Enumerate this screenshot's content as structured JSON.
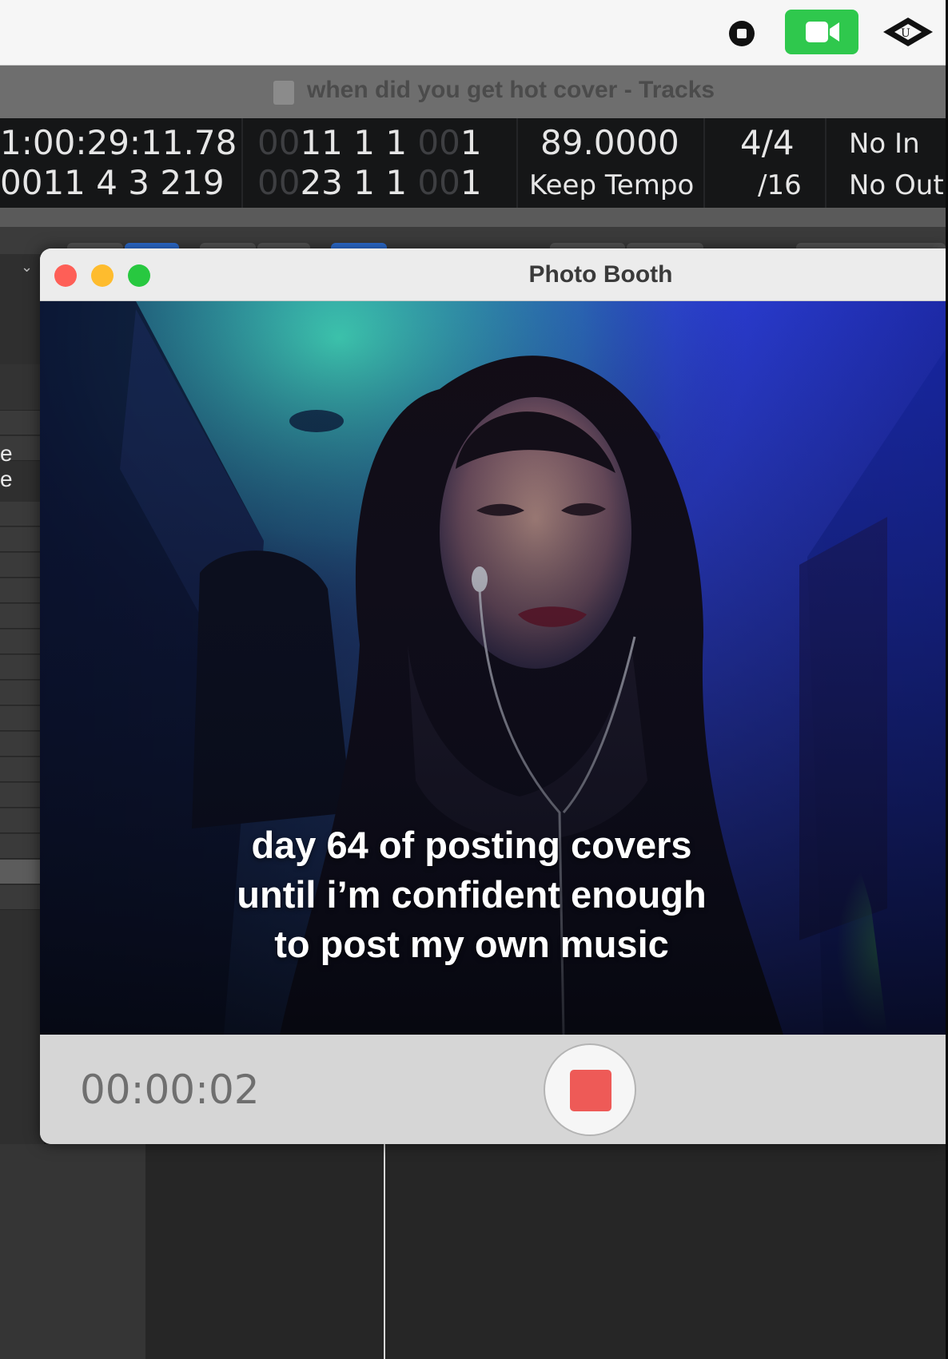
{
  "menubar": {
    "icons": [
      "screen-record-icon",
      "facetime-camera-icon",
      "universal-audio-icon"
    ],
    "facetime_color": "#2fc84d"
  },
  "logic": {
    "window_title": "when did you get hot cover - Tracks",
    "lcd": {
      "smpte_time": "1:00:29:11.78",
      "smpte_end": "0011 4 3 219",
      "bar_position": [
        "00",
        "11  1  1",
        "00",
        "1"
      ],
      "bar_end": [
        "00",
        "23  1  1",
        "00",
        "1"
      ],
      "tempo": "89.0000",
      "tempo_mode": "Keep Tempo",
      "time_signature": "4/4",
      "division": "/16",
      "input": "No In",
      "output": "No Out"
    },
    "side_labels": [
      "e",
      "e"
    ]
  },
  "photo_booth": {
    "title": "Photo Booth",
    "caption_lines": [
      "day 64 of posting covers",
      "until i’m confident enough",
      "to post my own music"
    ],
    "timer": "00:00:02",
    "record_state": "recording",
    "stop_color": "#ee5a57"
  }
}
